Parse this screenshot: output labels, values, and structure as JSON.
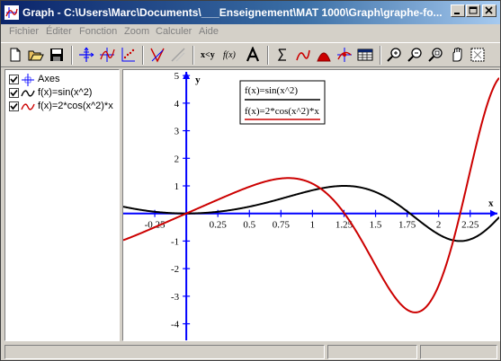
{
  "window": {
    "title": "Graph - C:\\Users\\Marc\\Documents\\___Enseignement\\MAT 1000\\Graph\\graphe-fo..."
  },
  "menu": [
    "Fichier",
    "Éditer",
    "Fonction",
    "Zoom",
    "Calculer",
    "Aide"
  ],
  "toolbar": {
    "buttons": [
      "new-file-icon",
      "open-folder-icon",
      "save-icon",
      "axes-icon",
      "insert-function-icon",
      "insert-point-series-icon",
      "insert-tangent-icon",
      "insert-shading-icon",
      "insert-relation-icon",
      "fx-icon",
      "insert-label-icon",
      "evaluate-icon",
      "table-icon",
      "zoom-in-icon",
      "zoom-out-icon",
      "zoom-square-icon",
      "move-system-icon",
      "zoom-standard-icon"
    ],
    "xy_label": "x<y",
    "fx_label": "f(x)"
  },
  "functions": {
    "items": [
      {
        "label": "Axes",
        "checked": true,
        "color": "#0000ff"
      },
      {
        "label": "f(x)=sin(x^2)",
        "checked": true,
        "color": "#000000"
      },
      {
        "label": "f(x)=2*cos(x^2)*x",
        "checked": true,
        "color": "#cc0000"
      }
    ]
  },
  "graph": {
    "legend": [
      {
        "label": "f(x)=sin(x^2)",
        "color": "#000000"
      },
      {
        "label": "f(x)=2*cos(x^2)*x",
        "color": "#cc0000"
      }
    ],
    "x_axis_label": "x",
    "y_axis_label": "y",
    "x_ticks": [
      "-0.25",
      "0.25",
      "0.5",
      "0.75",
      "1",
      "1.25",
      "1.5",
      "1.75",
      "2",
      "2.25"
    ],
    "y_ticks": [
      "5",
      "4",
      "3",
      "2",
      "1",
      "-1",
      "-2",
      "-3",
      "-4"
    ],
    "axes_color": "#0000ff"
  },
  "chart_data": [
    {
      "type": "line",
      "series": [
        {
          "name": "f(x)=sin(x^2)",
          "expression": "sin(x^2)",
          "color": "#000000"
        },
        {
          "name": "f(x)=2*cos(x^2)*x",
          "expression": "2*cos(x^2)*x",
          "color": "#cc0000"
        }
      ],
      "xlabel": "x",
      "ylabel": "y",
      "xlim": [
        -0.5,
        2.48
      ],
      "ylim": [
        -4.6,
        5.2
      ],
      "x_ticks": [
        -0.25,
        0.25,
        0.5,
        0.75,
        1,
        1.25,
        1.5,
        1.75,
        2,
        2.25
      ],
      "y_ticks": [
        -4,
        -3,
        -2,
        -1,
        1,
        2,
        3,
        4,
        5
      ],
      "grid": false,
      "legend": "top-center"
    }
  ]
}
